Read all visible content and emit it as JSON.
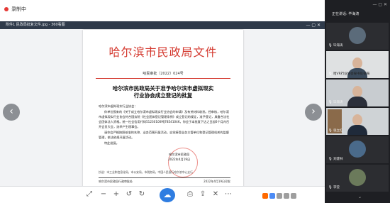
{
  "top": {
    "recording_label": "录制中"
  },
  "viewer": {
    "window_title": "附件1  民政局批复文件.jpg - 360看图",
    "nav_prev": "‹",
    "nav_next": "›"
  },
  "document": {
    "header": "哈尔滨市民政局文件",
    "doc_number": "哈民审批〔2022〕024号",
    "title_line1": "哈尔滨市民政局关于准予哈尔滨市虚拟现实",
    "title_line2": "行业协会成立登记的批复",
    "addressee": "哈尔滨市虚拟现实行业协会：",
    "paragraph1": "你单位报来的《关于成立哈尔滨市虚拟现实行业协会的申请》及有关材料收悉。经审核，哈尔滨市虚拟现实行业协会符合国务院《社会团体登记管理条例》成立登记的规定，准予登记，具备合法社会团体法人资格。统一社会信用代码51230100MJ7854104K，你会于本批复下达之日起6个月内召开会员大会，选举产生理事会。",
    "paragraph2": "请你会严格按照核准的名称、业务范围开展活动，自觉接受业务主管单位和登记管理机关的监督管理，依法依规开展活动。",
    "closing": "特此批复。",
    "signer": "哈尔滨市民政局",
    "sign_date": "2022年4月19日",
    "cc": "抄送：市工业和信息化局，市公安局，市税务局，中国人民银行哈尔滨中心支行",
    "footer_org": "哈尔滨市民政局行政审批处",
    "footer_date": "2022年4月19日印发"
  },
  "panel": {
    "header": "正在讲话: 毕海涛",
    "participants": [
      {
        "name": "毕海涛"
      },
      {
        "name": "哈VR行业协会秘书处张海"
      },
      {
        "name": "毕海涛"
      },
      {
        "name": "张立红"
      },
      {
        "name": "刘建林"
      },
      {
        "name": "李莹"
      }
    ]
  },
  "colors": {
    "doc_red": "#d4382e",
    "panel_bg": "#1e1f23",
    "cloud_blue": "#2f7de1"
  }
}
